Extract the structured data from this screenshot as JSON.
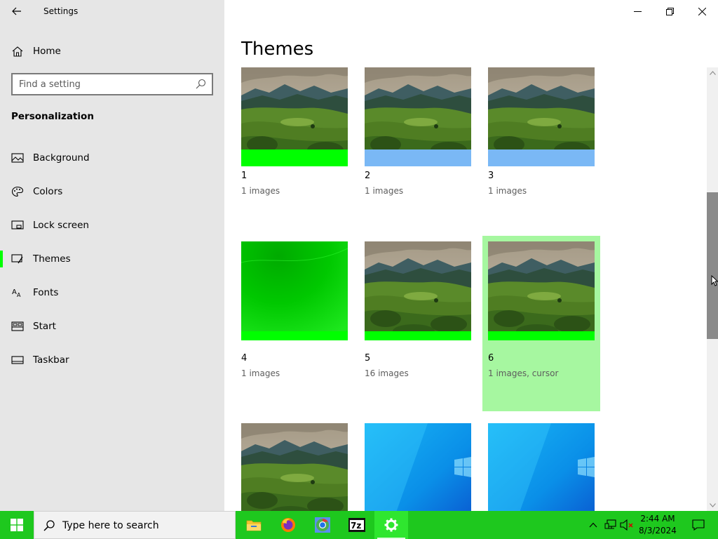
{
  "window": {
    "app_title": "Settings",
    "minimize_icon": "minimize-icon",
    "maximize_icon": "restore-icon",
    "close_icon": "close-icon"
  },
  "sidebar": {
    "home_label": "Home",
    "search_placeholder": "Find a setting",
    "section_title": "Personalization",
    "items": [
      {
        "label": "Background",
        "icon": "image-icon",
        "selected": false
      },
      {
        "label": "Colors",
        "icon": "palette-icon",
        "selected": false
      },
      {
        "label": "Lock screen",
        "icon": "lock-screen-icon",
        "selected": false
      },
      {
        "label": "Themes",
        "icon": "brush-icon",
        "selected": true
      },
      {
        "label": "Fonts",
        "icon": "font-icon",
        "selected": false
      },
      {
        "label": "Start",
        "icon": "start-menu-icon",
        "selected": false
      },
      {
        "label": "Taskbar",
        "icon": "taskbar-icon",
        "selected": false
      }
    ],
    "accent_color": "#00ff00"
  },
  "main": {
    "title": "Themes",
    "themes": [
      {
        "name": "1",
        "subtitle": "1 images",
        "image": "landscape",
        "band_color": "#00ff00",
        "selected": false
      },
      {
        "name": "2",
        "subtitle": "1 images",
        "image": "landscape",
        "band_color": "#7ab8f5",
        "selected": false
      },
      {
        "name": "3",
        "subtitle": "1 images",
        "image": "landscape",
        "band_color": "#7ab8f5",
        "selected": false
      },
      {
        "name": "4",
        "subtitle": "1 images",
        "image": "green-gradient",
        "band_color": "#00ff00",
        "selected": false
      },
      {
        "name": "5",
        "subtitle": "16 images",
        "image": "landscape",
        "band_color": "#00ff00",
        "selected": false
      },
      {
        "name": "6",
        "subtitle": "1 images, cursor",
        "image": "landscape",
        "band_color": "#00ff00",
        "selected": true
      },
      {
        "name": "",
        "subtitle": "",
        "image": "landscape",
        "band_color": "",
        "selected": false
      },
      {
        "name": "",
        "subtitle": "",
        "image": "windows-blue",
        "band_color": "",
        "selected": false
      },
      {
        "name": "",
        "subtitle": "",
        "image": "windows-blue",
        "band_color": "",
        "selected": false
      }
    ],
    "selected_bg_color": "#a6f7a0"
  },
  "taskbar": {
    "search_placeholder": "Type here to search",
    "apps": [
      {
        "name": "file-explorer",
        "icon": "folder-icon",
        "active": false
      },
      {
        "name": "firefox",
        "icon": "firefox-icon",
        "active": false
      },
      {
        "name": "chrome",
        "icon": "chrome-icon",
        "active": false
      },
      {
        "name": "7zip",
        "icon": "7zip-icon",
        "active": false
      },
      {
        "name": "settings",
        "icon": "gear-icon",
        "active": true
      }
    ],
    "time": "2:44 AM",
    "date": "8/3/2024",
    "color": "#1ec81e"
  }
}
